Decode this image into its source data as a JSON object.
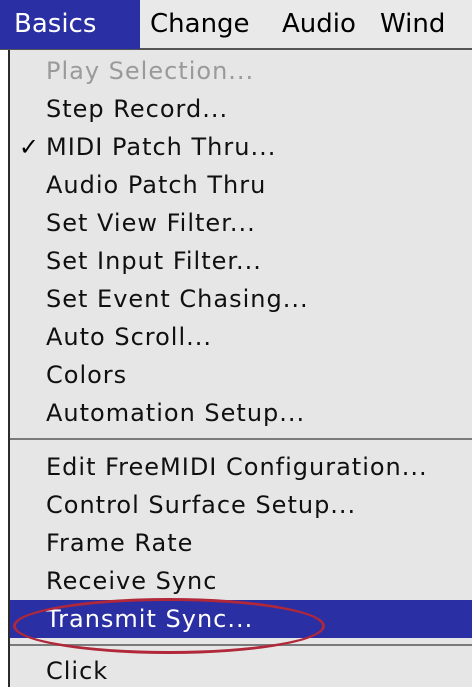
{
  "menubar": {
    "titles": [
      "Basics",
      "Change",
      "Audio",
      "Wind"
    ],
    "active_index": 0
  },
  "menu": {
    "items": [
      {
        "label": "Play Selection...",
        "disabled": true,
        "checked": false
      },
      {
        "label": "Step Record...",
        "disabled": false,
        "checked": false
      },
      {
        "label": "MIDI Patch Thru...",
        "disabled": false,
        "checked": true
      },
      {
        "label": "Audio Patch Thru",
        "disabled": false,
        "checked": false
      },
      {
        "label": "Set View Filter...",
        "disabled": false,
        "checked": false
      },
      {
        "label": "Set Input Filter...",
        "disabled": false,
        "checked": false
      },
      {
        "label": "Set Event Chasing...",
        "disabled": false,
        "checked": false
      },
      {
        "label": "Auto Scroll...",
        "disabled": false,
        "checked": false
      },
      {
        "label": "Colors",
        "disabled": false,
        "checked": false
      },
      {
        "label": "Automation Setup...",
        "disabled": false,
        "checked": false
      },
      {
        "label": "Edit FreeMIDI Configuration...",
        "disabled": false,
        "checked": false
      },
      {
        "label": "Control Surface Setup...",
        "disabled": false,
        "checked": false
      },
      {
        "label": "Frame Rate",
        "disabled": false,
        "checked": false
      },
      {
        "label": "Receive Sync",
        "disabled": false,
        "checked": false
      },
      {
        "label": "Transmit Sync...",
        "disabled": false,
        "checked": false,
        "highlighted": true
      },
      {
        "label": "Click",
        "disabled": false,
        "checked": false
      }
    ],
    "check_glyph": "✓"
  },
  "colors": {
    "highlight": "#2a2fa3",
    "annotation_oval": "#b0283a",
    "disabled_text": "#9a9a9a"
  }
}
